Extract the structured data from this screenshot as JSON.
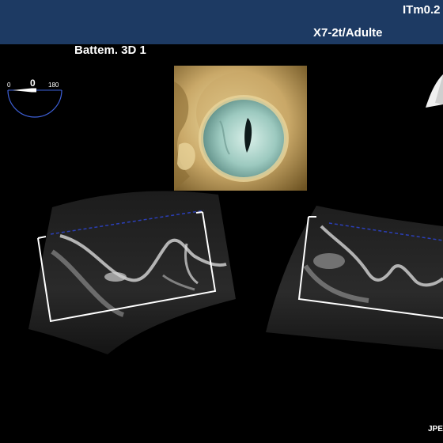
{
  "header": {
    "tis_label": "ITm0.2",
    "probe_label": "X7-2t/Adulte"
  },
  "viewer": {
    "mode_title": "Battem. 3D 1",
    "angle": {
      "min_label": "0",
      "value_label": "0",
      "max_label": "180"
    }
  },
  "footer": {
    "tag": "JPE"
  },
  "colors": {
    "header_bg": "#1d3a63",
    "bracket": "#ffffff",
    "cut_line": "#2b3fb8"
  },
  "icons": {
    "angle": "arc-gauge-icon",
    "orientation": "orientation-marker-icon"
  }
}
